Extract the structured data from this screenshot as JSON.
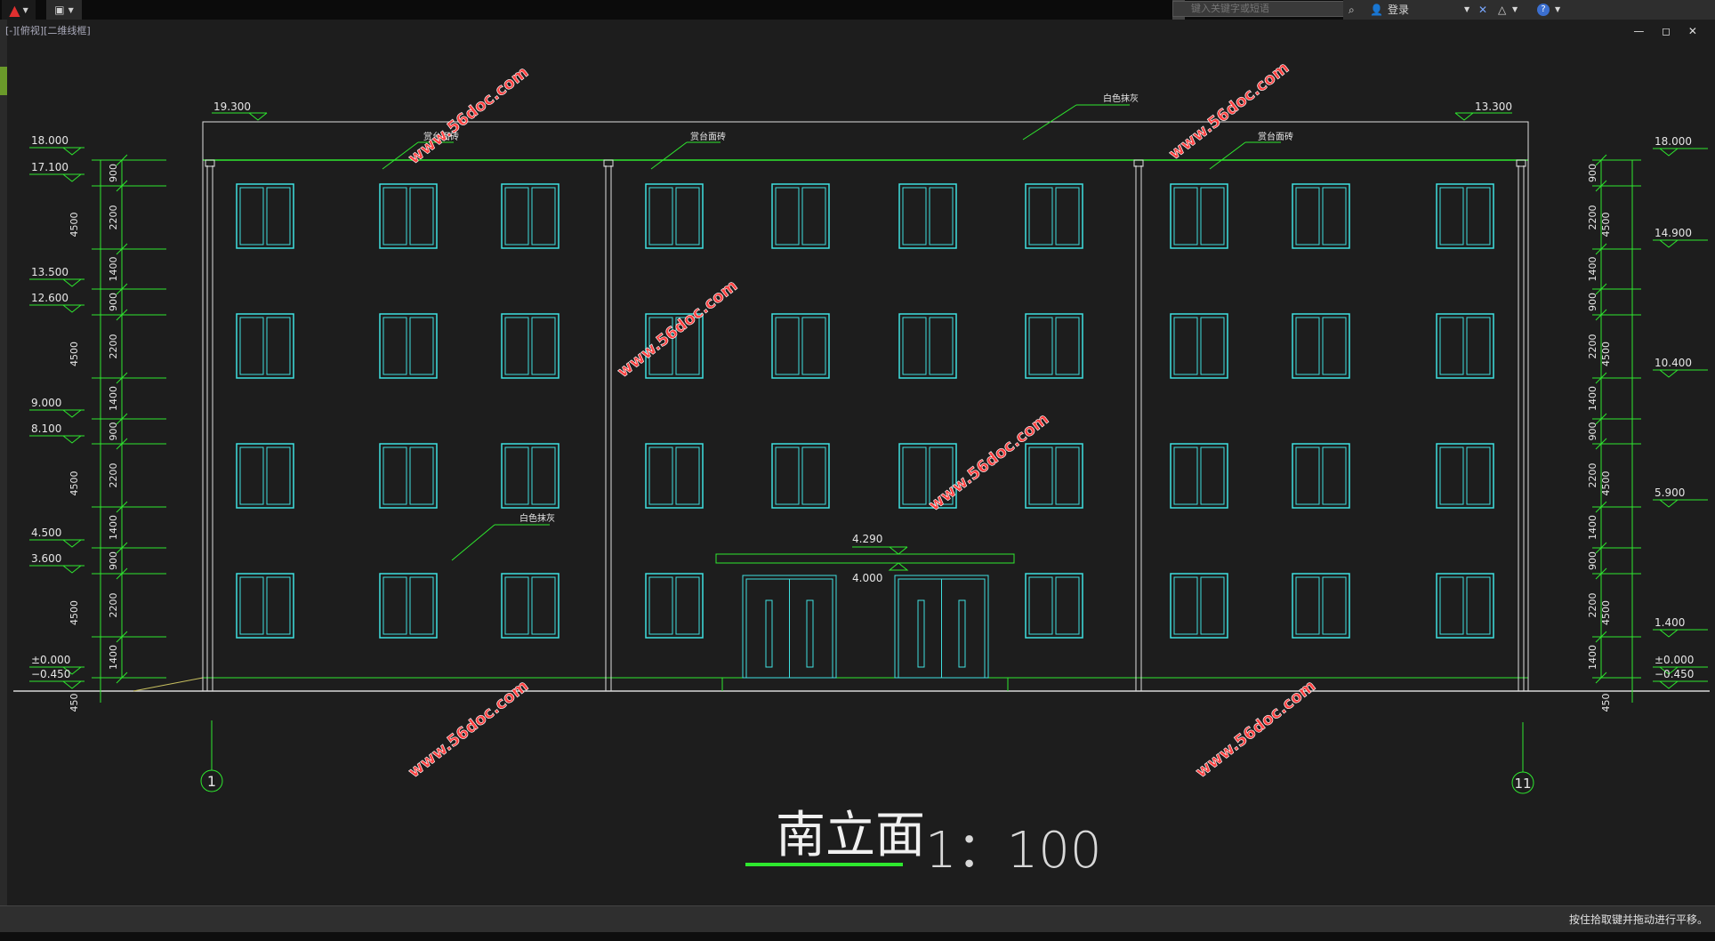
{
  "toolbar": {
    "search_placeholder": "键入关键字或短语",
    "login_label": "登录"
  },
  "viewport": {
    "label": "[-][俯视][二维线框]",
    "controls": "— ◻ ✕"
  },
  "drawing": {
    "title": "南立面",
    "scale": "1：100",
    "axis_left": "1",
    "axis_right": "11",
    "watermark": "www.56doc.com",
    "top_left_elev": "19.300",
    "top_right_elev": "13.300",
    "canopy_top": "4.290",
    "door_top": "4.000",
    "notes": [
      "赏台面砖",
      "赏台面砖",
      "白色抹灰",
      "赏台面砖",
      "白色抹灰"
    ],
    "left_elevations": [
      "18.000",
      "17.100",
      "13.500",
      "12.600",
      "9.000",
      "8.100",
      "4.500",
      "3.600",
      "±0.000",
      "−0.450"
    ],
    "right_elevations": [
      "18.000",
      "14.900",
      "10.400",
      "5.900",
      "1.400",
      "±0.000",
      "−0.450"
    ],
    "left_dims_inner": [
      "900",
      "2200",
      "1400",
      "900",
      "2200",
      "1400",
      "900",
      "2200",
      "1400",
      "900",
      "2200",
      "1400"
    ],
    "left_dims_outer": [
      "4500",
      "4500",
      "4500",
      "4500",
      "450"
    ],
    "right_dims_inner": [
      "900",
      "2200",
      "1400",
      "900",
      "2200",
      "1400",
      "900",
      "2200",
      "1400",
      "900",
      "2200",
      "1400"
    ],
    "right_dims_outer": [
      "4500",
      "4500",
      "4500",
      "4500",
      "450"
    ]
  },
  "status": {
    "hint": "按住拾取键并拖动进行平移。"
  },
  "colors": {
    "line": "#2ee82e",
    "window": "#3fe0e0",
    "text": "#e6e6e6",
    "watermark": "#ff4040"
  }
}
